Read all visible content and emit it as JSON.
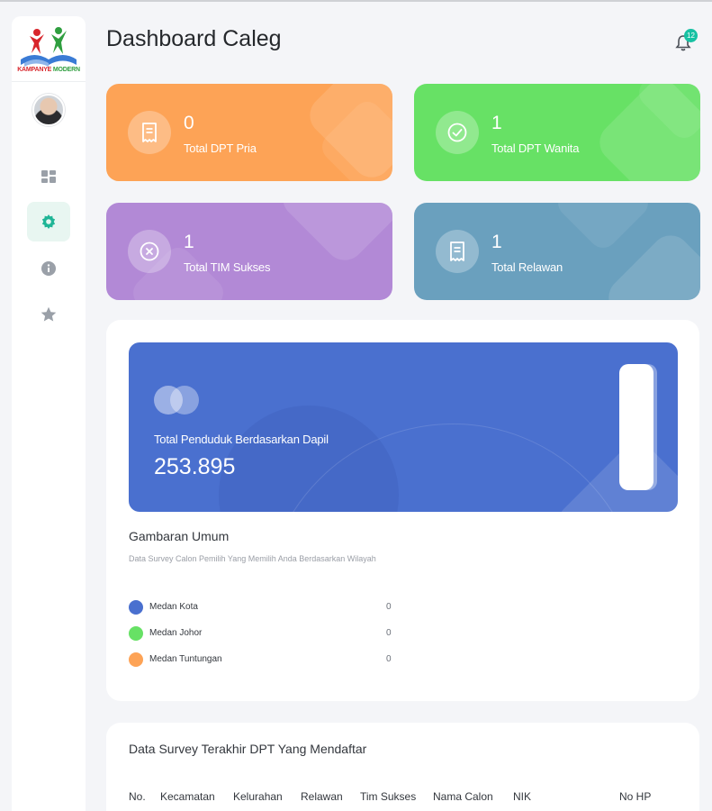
{
  "header": {
    "title": "Dashboard Caleg",
    "notification_count": "12"
  },
  "logo": {
    "text_part1": "KAMPANYE",
    "text_part2": "MODERN"
  },
  "sidebar": {
    "items": [
      {
        "icon": "dashboard-icon",
        "active": false
      },
      {
        "icon": "gear-icon",
        "active": true
      },
      {
        "icon": "info-icon",
        "active": false
      },
      {
        "icon": "star-icon",
        "active": false
      }
    ]
  },
  "stats": [
    {
      "value": "0",
      "label": "Total DPT Pria",
      "color": "#fda356",
      "icon": "receipt-icon"
    },
    {
      "value": "1",
      "label": "Total DPT Wanita",
      "color": "#67e165",
      "icon": "check-circle-icon"
    },
    {
      "value": "1",
      "label": "Total TIM Sukses",
      "color": "#b289d6",
      "icon": "close-circle-icon"
    },
    {
      "value": "1",
      "label": "Total Relawan",
      "color": "#6aa0be",
      "icon": "receipt-icon"
    }
  ],
  "banner": {
    "label": "Total Penduduk Berdasarkan Dapil",
    "value": "253.895",
    "color": "#4a70cf"
  },
  "overview": {
    "title": "Gambaran Umum",
    "subtitle": "Data Survey Calon Pemilih Yang Memilih Anda Berdasarkan Wilayah",
    "items": [
      {
        "name": "Medan Kota",
        "value": "0",
        "color": "#4a70cf"
      },
      {
        "name": "Medan Johor",
        "value": "0",
        "color": "#67e165"
      },
      {
        "name": "Medan Tuntungan",
        "value": "0",
        "color": "#fda356"
      }
    ]
  },
  "survey_table": {
    "title": "Data Survey Terakhir DPT Yang Mendaftar",
    "columns": [
      "No.",
      "Kecamatan",
      "Kelurahan",
      "Relawan",
      "Tim Sukses",
      "Nama Calon",
      "NIK",
      "No HP"
    ]
  }
}
